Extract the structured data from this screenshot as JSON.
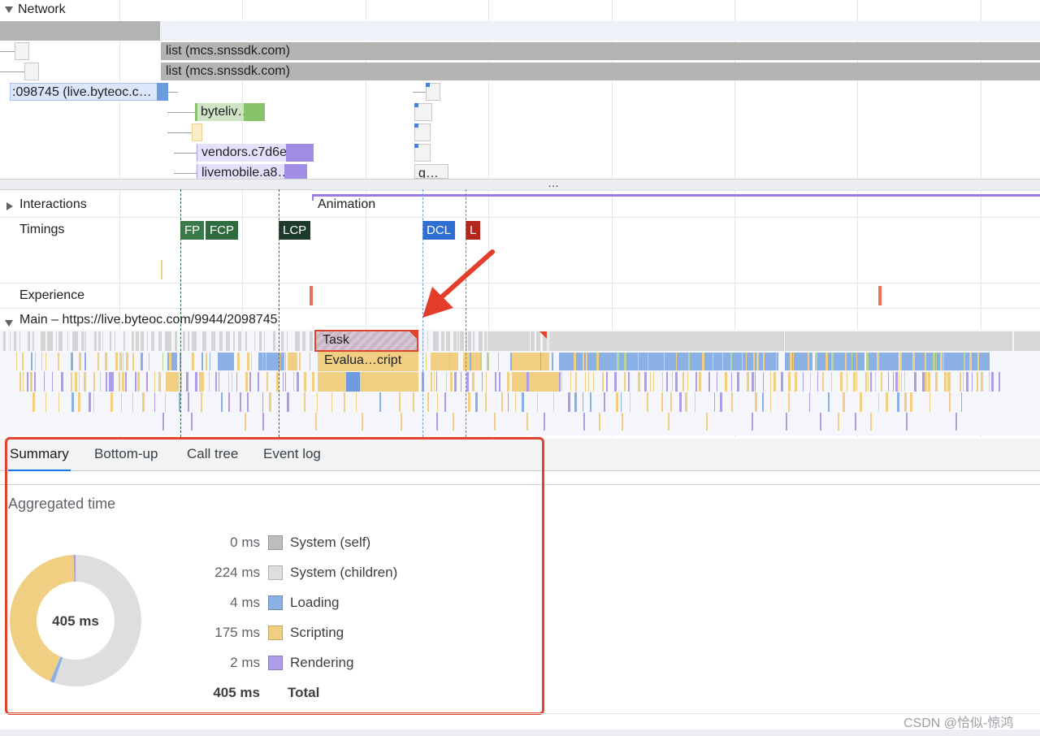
{
  "network": {
    "title": "Network",
    "requests": [
      {
        "label": "list (mcs.snssdk.com)"
      },
      {
        "label": "list (mcs.snssdk.com)"
      },
      {
        "label": ":098745 (live.byteoc.c…"
      },
      {
        "label": "byteliv…"
      },
      {
        "label": "vendors.c7d6e…"
      },
      {
        "label": "livemobile.a8…"
      },
      {
        "label": "g…"
      }
    ],
    "resize_handle": "…"
  },
  "tracks": {
    "interactions": "Interactions",
    "animation": "Animation",
    "timings": "Timings",
    "experience": "Experience",
    "main": "Main – https://live.byteoc.com/9944/2098745"
  },
  "timings": [
    {
      "label": "FP",
      "color": "#3a7a4a"
    },
    {
      "label": "FCP",
      "color": "#2e6b3e"
    },
    {
      "label": "LCP",
      "color": "#1e3a2a"
    },
    {
      "label": "DCL",
      "color": "#2f6fd1"
    },
    {
      "label": "L",
      "color": "#b3261e"
    }
  ],
  "flame": {
    "task_label": "Task",
    "eval_label": "Evalua…cript"
  },
  "tabs": [
    "Summary",
    "Bottom-up",
    "Call tree",
    "Event log"
  ],
  "summary": {
    "heading": "Aggregated time",
    "total_center": "405 ms",
    "rows": [
      {
        "value": "0 ms",
        "label": "System (self)",
        "color": "#bdbdbd",
        "ms": 0
      },
      {
        "value": "224 ms",
        "label": "System (children)",
        "color": "#dedede",
        "ms": 224
      },
      {
        "value": "4 ms",
        "label": "Loading",
        "color": "#8ab0e6",
        "ms": 4
      },
      {
        "value": "175 ms",
        "label": "Scripting",
        "color": "#f0cf83",
        "ms": 175
      },
      {
        "value": "2 ms",
        "label": "Rendering",
        "color": "#ad9ce8",
        "ms": 2
      }
    ],
    "total_value": "405 ms",
    "total_label": "Total"
  },
  "watermark": "CSDN @恰似-惊鸿",
  "colors": {
    "highlight_border": "#e0442f",
    "arrow": "#e53d2c",
    "scripting": "#f0cf83",
    "loading": "#8ab0e6",
    "rendering": "#ad9ce8",
    "task_grey": "#d4d4d4"
  }
}
